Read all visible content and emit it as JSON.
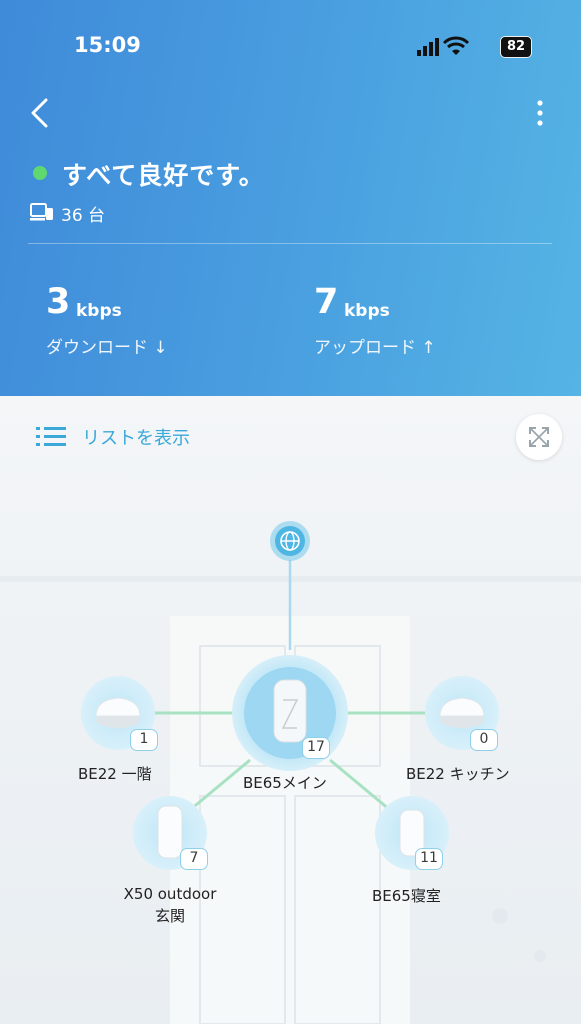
{
  "status_bar": {
    "time": "15:09",
    "battery": "82"
  },
  "header": {
    "status_text": "すべて良好です。",
    "device_count": "36 台",
    "download": {
      "value": "3",
      "unit": "kbps",
      "label": "ダウンロード ↓"
    },
    "upload": {
      "value": "7",
      "unit": "kbps",
      "label": "アップロード ↑"
    }
  },
  "toolbar": {
    "list_label": "リストを表示"
  },
  "nodes": [
    {
      "name": "BE22 一階",
      "count": "1"
    },
    {
      "name": "BE65メイン",
      "count": "17"
    },
    {
      "name": "BE22 キッチン",
      "count": "0"
    },
    {
      "name_line1": "X50 outdoor",
      "name_line2": "玄関",
      "count": "7"
    },
    {
      "name": "BE65寝室",
      "count": "11"
    }
  ],
  "colors": {
    "header_blue": "#4aa0e0",
    "ok_green": "#5fd870",
    "accent": "#3aa8d8"
  },
  "icons": [
    "back-chevron-icon",
    "more-vertical-icon",
    "device-icon",
    "list-icon",
    "expand-icon",
    "globe-icon",
    "router-icon"
  ]
}
